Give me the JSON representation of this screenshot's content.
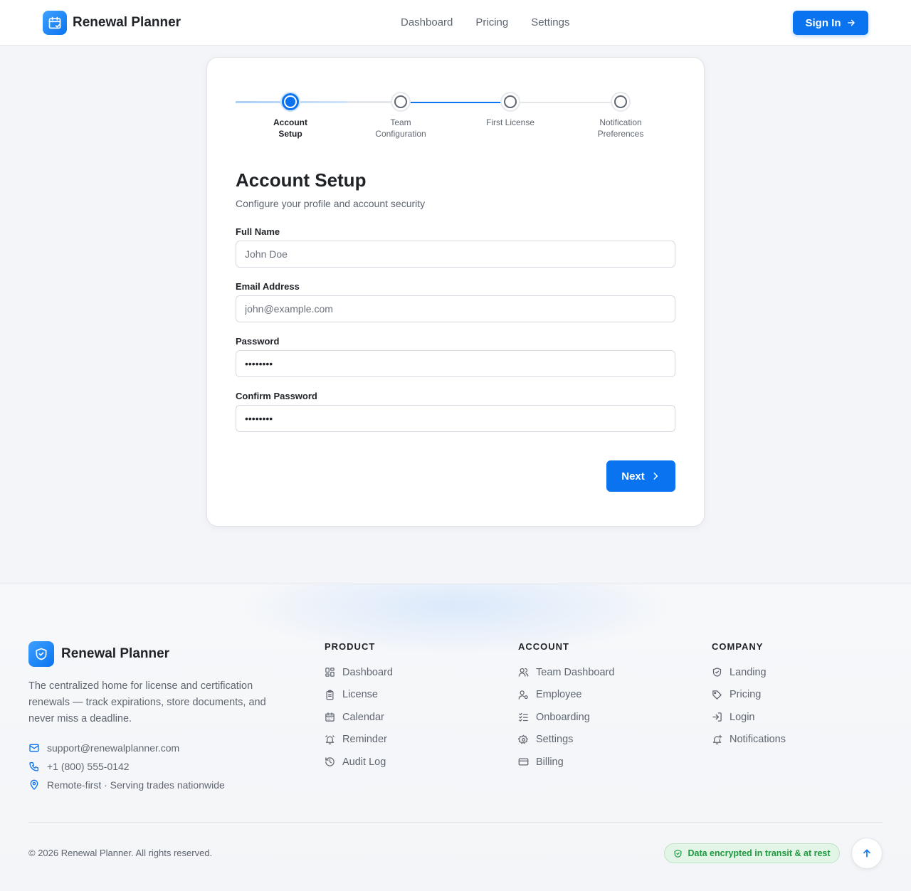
{
  "header": {
    "brand": "Renewal Planner",
    "nav": [
      "Dashboard",
      "Pricing",
      "Settings"
    ],
    "signin_label": "Sign In"
  },
  "stepper": {
    "steps": [
      {
        "label": "Account Setup",
        "active": true
      },
      {
        "label": "Team Configuration",
        "active": false
      },
      {
        "label": "First License",
        "active": false
      },
      {
        "label": "Notification Preferences",
        "active": false
      }
    ]
  },
  "form": {
    "title": "Account Setup",
    "subtitle": "Configure your profile and account security",
    "fields": [
      {
        "label": "Full Name",
        "placeholder": "John Doe",
        "value": ""
      },
      {
        "label": "Email Address",
        "placeholder": "john@example.com",
        "value": ""
      },
      {
        "label": "Password",
        "placeholder": "",
        "value": "••••••••"
      },
      {
        "label": "Confirm Password",
        "placeholder": "",
        "value": "••••••••"
      }
    ],
    "next_label": "Next"
  },
  "footer": {
    "brand": "Renewal Planner",
    "description": "The centralized home for license and certification renewals — track expirations, store documents, and never miss a deadline.",
    "contact": {
      "email": "support@renewalplanner.com",
      "phone": "+1 (800) 555-0142",
      "location": "Remote-first · Serving trades nationwide"
    },
    "columns": [
      {
        "title": "PRODUCT",
        "items": [
          {
            "label": "Dashboard",
            "icon": "dashboard-icon"
          },
          {
            "label": "License",
            "icon": "clipboard-icon"
          },
          {
            "label": "Calendar",
            "icon": "calendar-icon"
          },
          {
            "label": "Reminder",
            "icon": "bell-ring-icon"
          },
          {
            "label": "Audit Log",
            "icon": "history-icon"
          }
        ]
      },
      {
        "title": "ACCOUNT",
        "items": [
          {
            "label": "Team Dashboard",
            "icon": "users-icon"
          },
          {
            "label": "Employee",
            "icon": "user-cog-icon"
          },
          {
            "label": "Onboarding",
            "icon": "checklist-icon"
          },
          {
            "label": "Settings",
            "icon": "gear-icon"
          },
          {
            "label": "Billing",
            "icon": "credit-card-icon"
          }
        ]
      },
      {
        "title": "COMPANY",
        "items": [
          {
            "label": "Landing",
            "icon": "shield-icon"
          },
          {
            "label": "Pricing",
            "icon": "tag-icon"
          },
          {
            "label": "Login",
            "icon": "login-icon"
          },
          {
            "label": "Notifications",
            "icon": "bell-plus-icon"
          }
        ]
      }
    ],
    "copyright": "© 2026 Renewal Planner. All rights reserved.",
    "badge": "Data encrypted in transit & at rest"
  },
  "colors": {
    "primary": "#0a74f0",
    "success": "#1f9a3e",
    "background": "#f3f5f9"
  }
}
